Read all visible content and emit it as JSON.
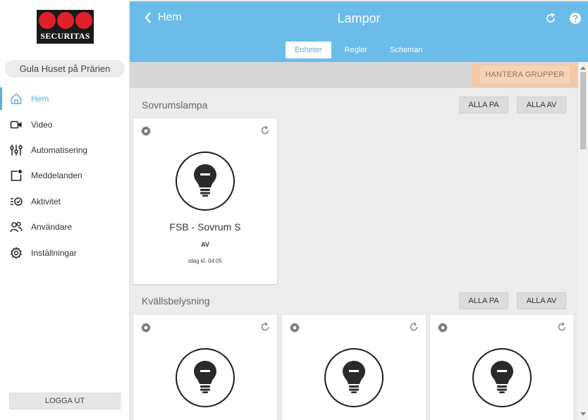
{
  "brand": {
    "logo_text": "SECURITAS",
    "logo_color": "#e0202a"
  },
  "sidebar": {
    "home_name": "Gula Huset på Prärien",
    "items": [
      {
        "label": "Hem",
        "icon": "home-icon",
        "active": true
      },
      {
        "label": "Video",
        "icon": "video-camera-icon"
      },
      {
        "label": "Automatisering",
        "icon": "sliders-icon"
      },
      {
        "label": "Meddelanden",
        "icon": "message-icon"
      },
      {
        "label": "Aktivitet",
        "icon": "activity-icon"
      },
      {
        "label": "Användare",
        "icon": "users-icon"
      },
      {
        "label": "Inställningar",
        "icon": "settings-icon"
      }
    ],
    "logout_label": "LOGGA UT"
  },
  "header": {
    "back_label": "Hem",
    "title": "Lampor",
    "tabs": [
      {
        "label": "Enheter",
        "active": true
      },
      {
        "label": "Regler"
      },
      {
        "label": "Scheman"
      }
    ],
    "accent_color": "#6cbcea"
  },
  "manage_groups_label": "HANTERA GRUPPER",
  "groups": [
    {
      "title": "Sovrumslampa",
      "all_on_label": "ALLA PA",
      "all_off_label": "ALLA AV",
      "devices": [
        {
          "name": "FSB - Sovrum S",
          "state": "AV",
          "time": "Idag kl. 04:05"
        }
      ]
    },
    {
      "title": "Kvällsbelysning",
      "all_on_label": "ALLA PA",
      "all_off_label": "ALLA AV",
      "devices": [
        {},
        {},
        {}
      ]
    }
  ]
}
